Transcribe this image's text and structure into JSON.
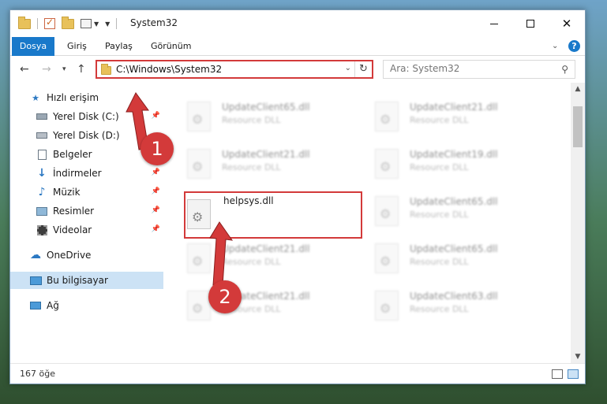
{
  "window": {
    "title": "System32"
  },
  "ribbon": {
    "tabs": [
      "Dosya",
      "Giriş",
      "Paylaş",
      "Görünüm"
    ],
    "help_label": "?"
  },
  "address": {
    "path": "C:\\Windows\\System32",
    "search_placeholder": "Ara: System32"
  },
  "sidebar": {
    "items": [
      {
        "label": "Hızlı erişim",
        "icon": "star-icon"
      },
      {
        "label": "Yerel Disk (C:)",
        "icon": "drive-icon",
        "pinned": true
      },
      {
        "label": "Yerel Disk (D:)",
        "icon": "drive-icon"
      },
      {
        "label": "Belgeler",
        "icon": "documents-icon",
        "pinned": true
      },
      {
        "label": "İndirmeler",
        "icon": "download-icon",
        "pinned": true
      },
      {
        "label": "Müzik",
        "icon": "music-icon",
        "pinned": true
      },
      {
        "label": "Resimler",
        "icon": "pictures-icon",
        "pinned": true
      },
      {
        "label": "Videolar",
        "icon": "video-icon",
        "pinned": true
      },
      {
        "label": "OneDrive",
        "icon": "cloud-icon"
      },
      {
        "label": "Bu bilgisayar",
        "icon": "computer-icon",
        "selected": true
      },
      {
        "label": "Ağ",
        "icon": "network-icon"
      }
    ]
  },
  "files": [
    {
      "name": "UpdateClient65.dll",
      "type": "Resource DLL"
    },
    {
      "name": "UpdateClient21.dll",
      "type": "Resource DLL"
    },
    {
      "name": "UpdateClient21.dll",
      "type": "Resource DLL"
    },
    {
      "name": "UpdateClient19.dll",
      "type": "Resource DLL"
    },
    {
      "name": "helpsys.dll",
      "type": ""
    },
    {
      "name": "UpdateClient65.dll",
      "type": "Resource DLL"
    },
    {
      "name": "UpdateClient21.dll",
      "type": "Resource DLL"
    },
    {
      "name": "UpdateClient65.dll",
      "type": "Resource DLL"
    },
    {
      "name": "UpdateClient21.dll",
      "type": "Resource DLL"
    },
    {
      "name": "UpdateClient63.dll",
      "type": "Resource DLL"
    }
  ],
  "status": {
    "item_count": "167 öğe"
  },
  "annotations": {
    "step1": "1",
    "step2": "2",
    "color": "#d33a3a"
  }
}
